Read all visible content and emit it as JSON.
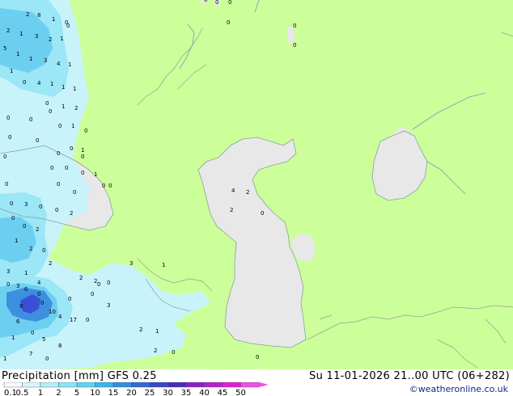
{
  "header": {
    "title": "Precipitation [mm]  GFS 0.25",
    "run_info": "Su 11-01-2026 21..00 UTC (06+282)",
    "credit": "©weatheronline.co.uk"
  },
  "legend": {
    "values": [
      "0.1",
      "0.5",
      "1",
      "2",
      "5",
      "10",
      "15",
      "20",
      "25",
      "30",
      "35",
      "40",
      "45",
      "50"
    ],
    "colors": [
      "#f4fbfd",
      "#d9f5fa",
      "#b4eef8",
      "#8ce4f5",
      "#5fd4ee",
      "#38b6e8",
      "#2e8fdd",
      "#2f6ad6",
      "#3448cf",
      "#4a2bb8",
      "#8a1fc6",
      "#b91ed0",
      "#e01ed6",
      "#f14fe5"
    ]
  },
  "map": {
    "land_color": "#ccff99",
    "sea_color": "#e8e8e8",
    "precip_colors": {
      "light": "#c8f3fa",
      "moderate": "#9be6f7",
      "heavy": "#6ccff0",
      "very_heavy": "#3d8fe0",
      "extreme": "#3a4fd6"
    },
    "point_labels": [
      "2",
      "8",
      "1",
      "0",
      "2",
      "1",
      "3",
      "2",
      "1",
      "0",
      "5",
      "1",
      "1",
      "3",
      "4",
      "1",
      "1",
      "0",
      "4",
      "1",
      "1",
      "1",
      "0",
      "1",
      "2",
      "0",
      "0",
      "0",
      "1",
      "0",
      "0",
      "0",
      "0",
      "1",
      "0",
      "0",
      "0",
      "0",
      "0",
      "1",
      "0",
      "0",
      "0",
      "0",
      "3",
      "0",
      "0",
      "2",
      "0",
      "0",
      "2",
      "1",
      "2",
      "0",
      "2",
      "3",
      "1",
      "3",
      "4",
      "2",
      "2",
      "0",
      "3",
      "1",
      "0",
      "0",
      "0",
      "0",
      "8",
      "10",
      "4",
      "17",
      "6",
      "0",
      "1",
      "5",
      "8",
      "7",
      "0",
      "1",
      "2",
      "0",
      "2",
      "1",
      "3",
      "0",
      "4",
      "2",
      "2",
      "0",
      "0",
      "0",
      "0",
      "0",
      "0",
      "0",
      "0",
      "0",
      "0",
      "0",
      "0",
      "0",
      "0",
      "0"
    ]
  }
}
